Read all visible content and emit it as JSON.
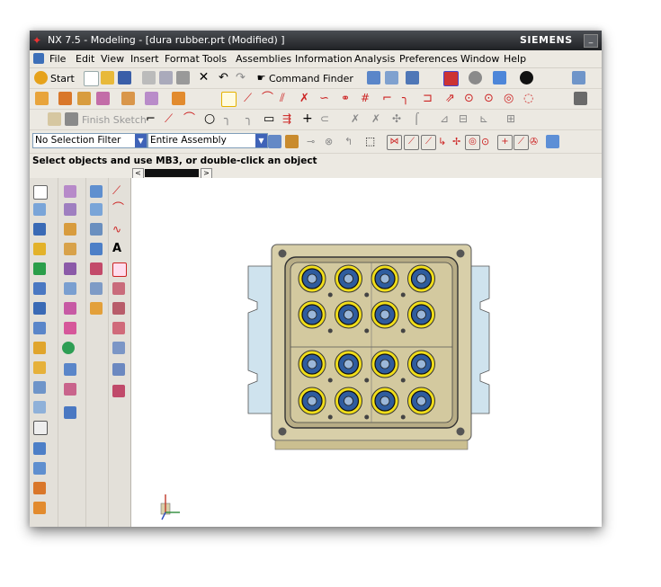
{
  "window": {
    "title": "NX 7.5 - Modeling - [dura rubber.prt (Modified) ]",
    "brand": "SIEMENS",
    "minimize_glyph": "_"
  },
  "menu": [
    "File",
    "Edit",
    "View",
    "Insert",
    "Format",
    "Tools",
    "Assemblies",
    "Information",
    "Analysis",
    "Preferences",
    "Window",
    "Help"
  ],
  "toolbar1": {
    "start_label": "Start",
    "command_finder_label": "Command Finder"
  },
  "toolbar3": {
    "finish_sketch_label": "Finish Sketch"
  },
  "selection_bar": {
    "filter_value": "No Selection Filter",
    "scope_value": "Entire Assembly"
  },
  "status": {
    "prompt": "Select objects and use MB3, or double-click an object"
  },
  "tabs": {
    "prev_glyph": "<",
    "next_glyph": ">"
  },
  "palette_text_glyph": "A",
  "colors": {
    "titlebar": "#2c2e31",
    "toolbar_bg": "#ece9e2",
    "viewport_bg": "#ffffff",
    "mold_plate": "#d8cfa9",
    "cavity_ring": "#f0dd1a",
    "cavity_core": "#2f5c9e",
    "side_plate": "#cfe3ee"
  },
  "model": {
    "rows": 4,
    "cols": 4
  }
}
